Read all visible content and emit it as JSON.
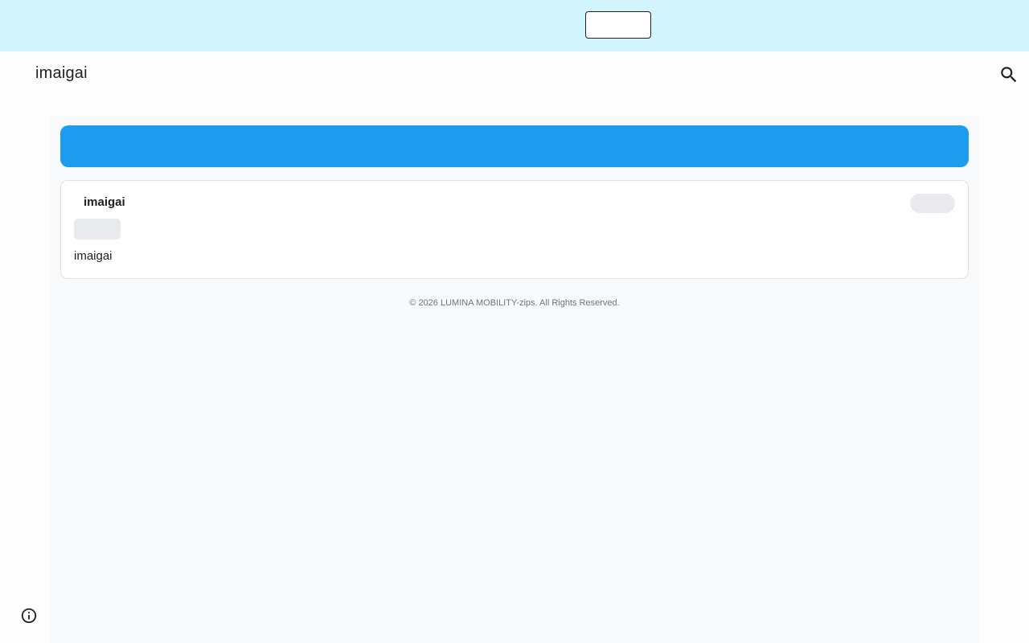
{
  "banner": {
    "background_color": "#d2f4fc",
    "button_label": ""
  },
  "header": {
    "site_title": "imaigai",
    "search_icon": "search-icon"
  },
  "main": {
    "accent_bar_color": "#1e9cf0",
    "card": {
      "title": "imaigai",
      "body_text": "imaigai"
    },
    "footer": "© 2026 LUMINA MOBILITY-zips. All Rights Reserved."
  },
  "page_info_icon": "info-icon"
}
